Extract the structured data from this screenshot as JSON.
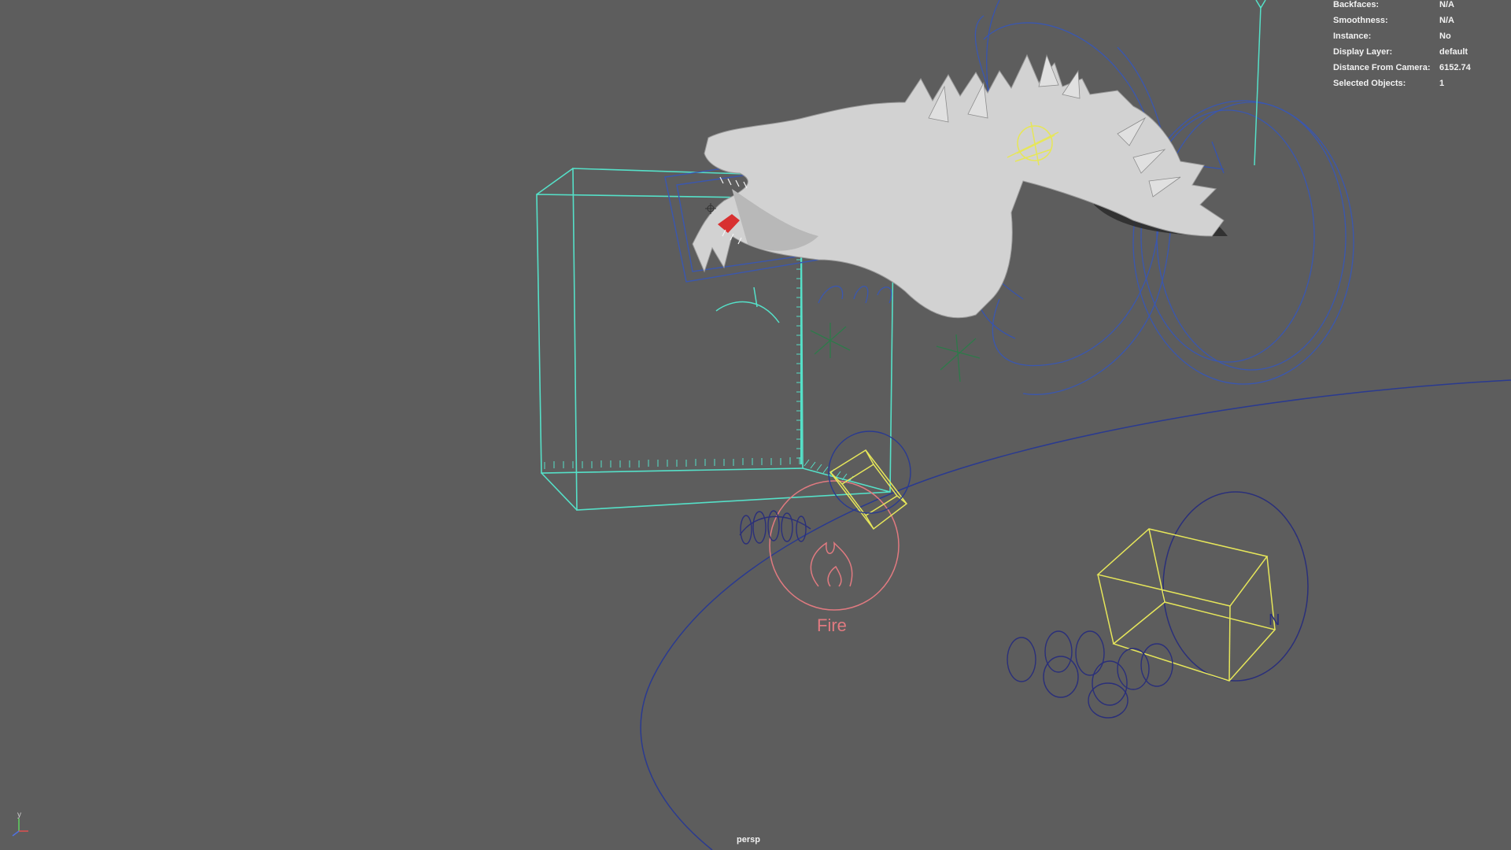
{
  "hud": {
    "rows": [
      {
        "label": "Backfaces:",
        "value": "N/A"
      },
      {
        "label": "Smoothness:",
        "value": "N/A"
      },
      {
        "label": "Instance:",
        "value": "No"
      },
      {
        "label": "Display Layer:",
        "value": "default"
      },
      {
        "label": "Distance From Camera:",
        "value": "6152.74"
      },
      {
        "label": "Selected Objects:",
        "value": "1"
      }
    ]
  },
  "viewport": {
    "camera": "persp",
    "fire_label": "Fire",
    "newton_label": "N"
  },
  "axis_gizmo": {
    "y": "y"
  },
  "colors": {
    "background": "#5d5d5d",
    "selection_cyan": "#55e0c8",
    "curve_blue": "#2a3f9a",
    "locator_yellow": "#e6e65a",
    "fire_pink": "#e07a80",
    "dragon_mesh": "#d2d2d2"
  }
}
